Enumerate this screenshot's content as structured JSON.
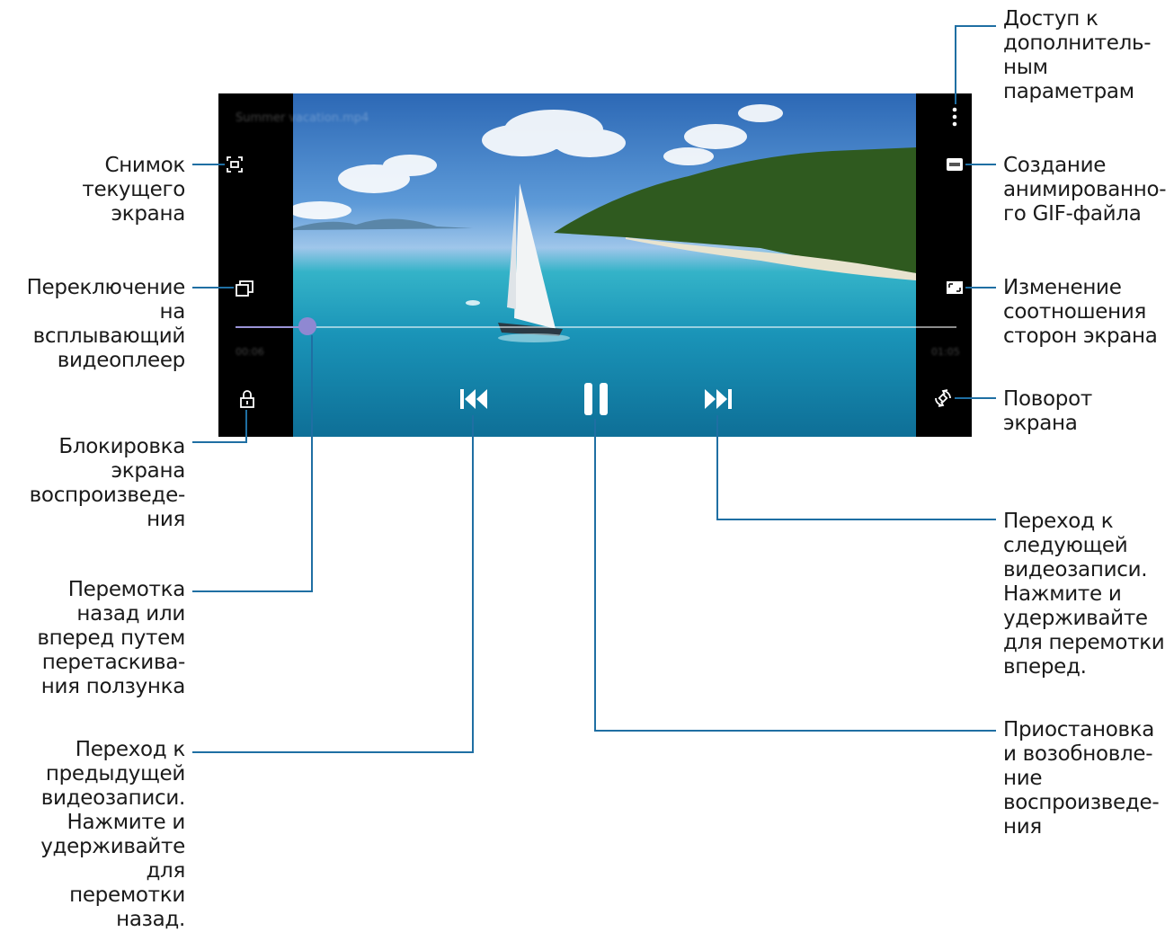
{
  "player": {
    "video_title": "Summer vacation.mp4",
    "elapsed_time": "00:06",
    "total_time": "01:05",
    "seek_progress": 0.1
  },
  "icons": {
    "capture": "screenshot-capture-icon",
    "popup": "popup-player-icon",
    "lock": "lock-icon",
    "more": "more-options-icon",
    "gif": "gif-icon",
    "ratio": "aspect-ratio-icon",
    "rotate": "rotate-screen-icon",
    "previous": "skip-previous-icon",
    "pause": "pause-icon",
    "next": "skip-next-icon"
  },
  "callouts": {
    "capture": "Снимок\nтекущего\nэкрана",
    "popup": "Переключение\nна\nвсплывающий\nвидеоплеер",
    "lock": "Блокировка\nэкрана\nвоспроизведе-\nния",
    "seek": "Перемотка\nназад или\nвперед путем\nперетаскива-\nния ползунка",
    "previous": "Переход к\nпредыдущей\nвидеозаписи.\nНажмите и\nудерживайте для\nперемотки назад.",
    "more": "Доступ к\nдополнитель-\nным\nпараметрам",
    "gif": "Создание\nанимированно-\nго GIF-файла",
    "ratio": "Изменение\nсоотношения\nсторон экрана",
    "rotate": "Поворот\nэкрана",
    "next": "Переход к\nследующей\nвидеозаписи.\nНажмите и\nудерживайте\nдля перемотки\nвперед.",
    "pause": "Приостановка\nи возобновле-\nние\nвоспроизведе-\nния"
  },
  "colors": {
    "leader": "#1f6fa3",
    "seek_accent": "#8f88d2"
  }
}
